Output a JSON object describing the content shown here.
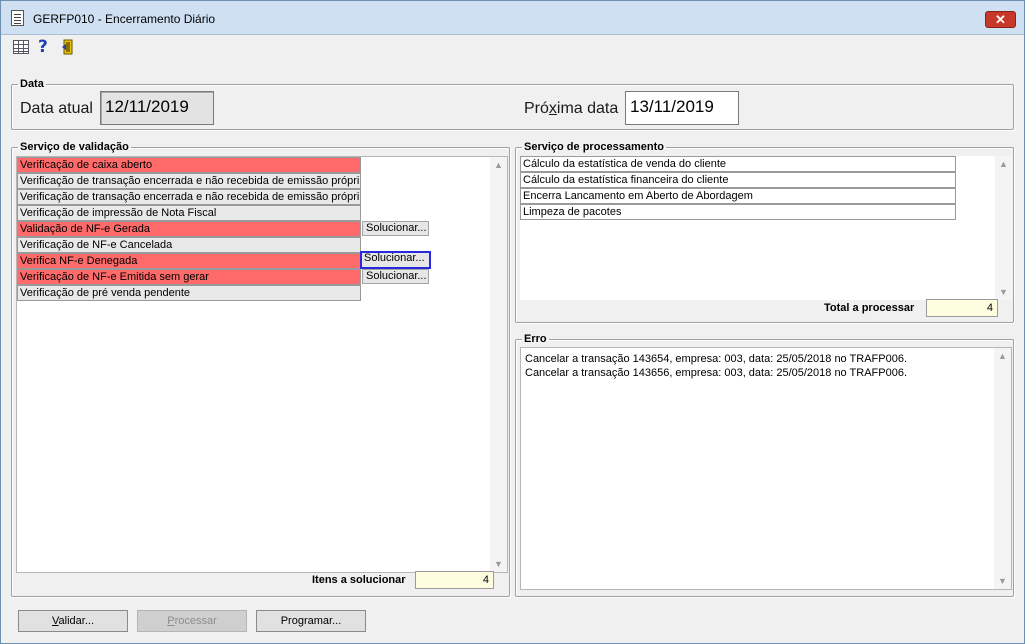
{
  "window": {
    "title": "GERFP010 - Encerramento Diário",
    "close_label": "✕"
  },
  "toolbar": {
    "icons": [
      "table-icon",
      "help-icon",
      "exit-door-icon"
    ],
    "help_glyph": "?"
  },
  "data_section": {
    "legend": "Data",
    "current_label": "Data atual",
    "current_value": "12/11/2019",
    "next_label_pre": "Pró",
    "next_label_ul": "x",
    "next_label_post": "ima data",
    "next_value": "13/11/2019"
  },
  "validation": {
    "legend": "Serviço de validação",
    "items": [
      {
        "label": "Verificação de caixa aberto",
        "status": "red"
      },
      {
        "label": "Verificação de transação encerrada e não recebida de emissão própri",
        "status": "grey"
      },
      {
        "label": "Verificação de transação encerrada e não recebida de emissão própri",
        "status": "grey"
      },
      {
        "label": "Verificação de impressão de Nota Fiscal",
        "status": "grey"
      },
      {
        "label": "Validação de NF-e Gerada",
        "status": "red",
        "action": "Solucionar..."
      },
      {
        "label": "Verificação de NF-e Cancelada",
        "status": "grey"
      },
      {
        "label": "Verifica NF-e Denegada",
        "status": "red",
        "action": "Solucionar..."
      },
      {
        "label": "Verificação de NF-e Emitida sem gerar",
        "status": "red",
        "action": "Solucionar..."
      },
      {
        "label": "Verificação de pré venda pendente",
        "status": "grey"
      }
    ],
    "count_label": "Itens a solucionar",
    "count_value": "4"
  },
  "processing": {
    "legend": "Serviço de processamento",
    "items": [
      "Cálculo da estatística de venda do cliente",
      "Cálculo da estatística financeira do cliente",
      "Encerra Lancamento em Aberto de Abordagem",
      "Limpeza de pacotes"
    ],
    "count_label": "Total a processar",
    "count_value": "4"
  },
  "error": {
    "legend": "Erro",
    "lines": [
      "Cancelar a transação 143654, empresa: 003, data: 25/05/2018 no TRAFP006.",
      "Cancelar a transação 143656, empresa: 003, data: 25/05/2018 no TRAFP006."
    ]
  },
  "buttons": {
    "validate_ul": "V",
    "validate_rest": "alidar...",
    "process_ul": "P",
    "process_rest": "rocessar",
    "schedule_pre": "Pro",
    "schedule_ul": "g",
    "schedule_post": "ramar..."
  },
  "colors": {
    "error_row": "#ff6b6b",
    "focus_border": "#2828e0",
    "count_bg": "#fdfde0"
  }
}
